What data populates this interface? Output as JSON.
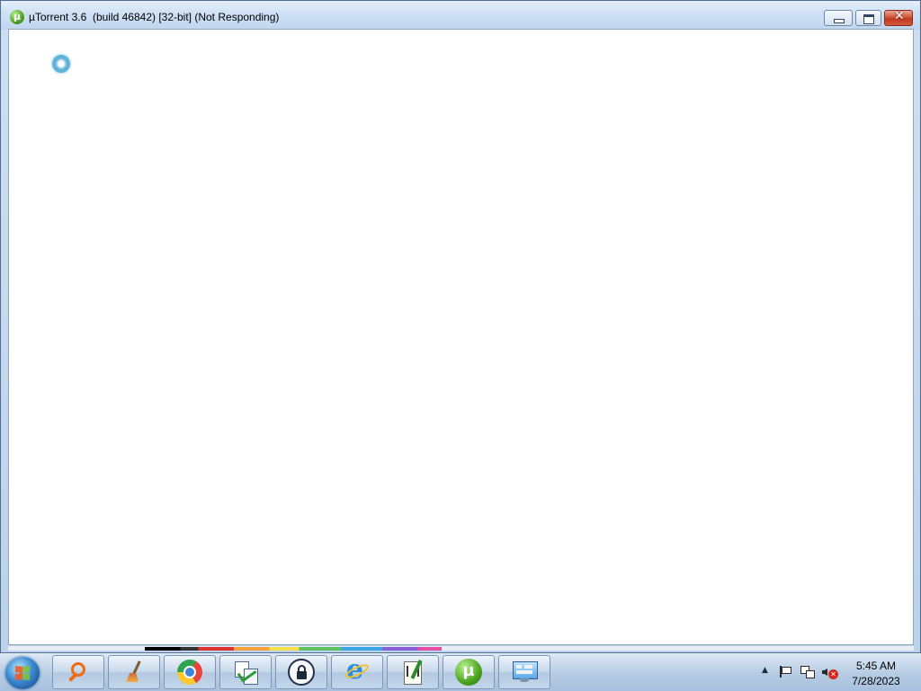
{
  "window": {
    "title": "µTorrent 3.6  (build 46842) [32-bit] (Not Responding)",
    "app_icon": "utorrent-icon",
    "controls": [
      "minimize",
      "maximize",
      "close"
    ],
    "state": "not-responding",
    "cursor": "busy-cursor"
  },
  "taskbar": {
    "start_button": "windows-start-orb",
    "pinned": [
      {
        "name": "search-tool",
        "icon": "magnifier-icon"
      },
      {
        "name": "cleaner",
        "icon": "broom-icon"
      },
      {
        "name": "google-chrome",
        "icon": "chrome-icon"
      },
      {
        "name": "sync-tool",
        "icon": "sync-docs-icon"
      },
      {
        "name": "vpn-lock",
        "icon": "lock-icon"
      },
      {
        "name": "internet-explorer",
        "icon": "ie-icon"
      },
      {
        "name": "notepad-plus-plus",
        "icon": "notepad-icon"
      },
      {
        "name": "utorrent",
        "icon": "utorrent-icon"
      },
      {
        "name": "control-panel",
        "icon": "control-panel-icon"
      }
    ],
    "tray": {
      "icons": [
        "show-hidden-icons",
        "action-center-flag-icon",
        "network-icon",
        "volume-muted-icon"
      ],
      "time": "5:45 AM",
      "date": "7/28/2023"
    }
  },
  "colors": {
    "titlebar": "#cddff3",
    "taskbar": "#b8cde4",
    "utorrent_green": "#4aa220",
    "close_red": "#c0391f"
  }
}
